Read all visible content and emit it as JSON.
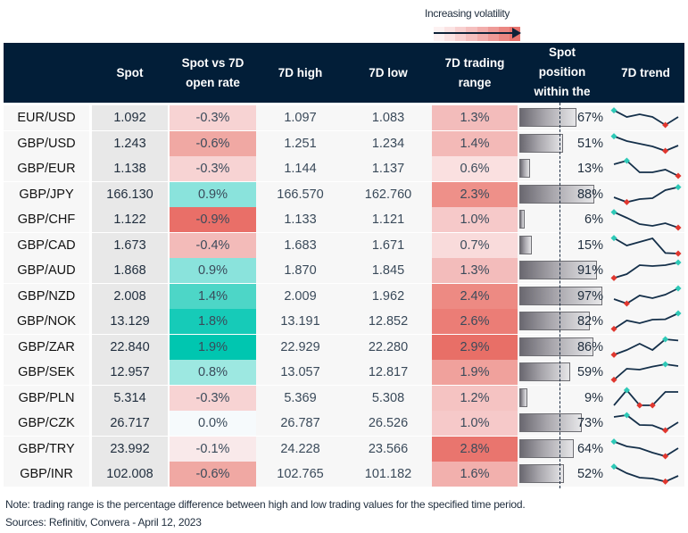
{
  "legend": {
    "label": "Increasing volatility",
    "gradient_colors": [
      "#fdf2f2",
      "#fbe3e3",
      "#f8d0d0",
      "#f5bfbe",
      "#f2adab",
      "#ee9a97",
      "#eb8782",
      "#e8736d"
    ]
  },
  "header": {
    "columns": [
      {
        "key": "pair",
        "label": ""
      },
      {
        "key": "spot",
        "label": "Spot"
      },
      {
        "key": "pct",
        "label": "Spot vs 7D open rate"
      },
      {
        "key": "high",
        "label": "7D high"
      },
      {
        "key": "low",
        "label": "7D low"
      },
      {
        "key": "range",
        "label": "7D trading range"
      },
      {
        "key": "pos",
        "label": "Spot position within the"
      },
      {
        "key": "trend",
        "label": "7D trend"
      }
    ]
  },
  "colors": {
    "header_bg": "#021e38",
    "trend_line": "#15304a",
    "trend_high_marker": "#2ec9b7",
    "trend_low_marker": "#e0372f"
  },
  "rows": [
    {
      "pair": "EUR/USD",
      "spot": "1.092",
      "pct": "-0.3%",
      "pct_color": "#f7d3d3",
      "high": "1.097",
      "low": "1.083",
      "range": "1.3%",
      "range_color": "#f3bcbb",
      "pos": "67%",
      "pos_value": 0.67,
      "trend": [
        0.92,
        0.55,
        0.7,
        0.55,
        0.1,
        0.55
      ],
      "trend_hi": 0,
      "trend_lo": [
        4
      ]
    },
    {
      "pair": "GBP/USD",
      "spot": "1.243",
      "pct": "-0.6%",
      "pct_color": "#f0a8a3",
      "high": "1.251",
      "low": "1.234",
      "range": "1.4%",
      "range_color": "#f3b9b7",
      "pos": "51%",
      "pos_value": 0.51,
      "trend": [
        0.92,
        0.65,
        0.5,
        0.35,
        0.1,
        0.4
      ],
      "trend_hi": 0,
      "trend_lo": [
        4
      ]
    },
    {
      "pair": "GBP/EUR",
      "spot": "1.138",
      "pct": "-0.3%",
      "pct_color": "#f7d3d3",
      "high": "1.144",
      "low": "1.137",
      "range": "0.6%",
      "range_color": "#fae0e0",
      "pos": "13%",
      "pos_value": 0.13,
      "trend": [
        0.75,
        0.95,
        0.3,
        0.3,
        0.45,
        0.1
      ],
      "trend_hi": 1,
      "trend_lo": [
        5
      ]
    },
    {
      "pair": "GBP/JPY",
      "spot": "166.130",
      "pct": "0.9%",
      "pct_color": "#8ae3dc",
      "high": "166.570",
      "low": "162.760",
      "range": "2.3%",
      "range_color": "#ee9089",
      "pos": "88%",
      "pos_value": 0.88,
      "trend": [
        0.35,
        0.08,
        0.25,
        0.3,
        0.75,
        0.92
      ],
      "trend_hi": 5,
      "trend_lo": [
        1
      ]
    },
    {
      "pair": "GBP/CHF",
      "spot": "1.122",
      "pct": "-0.9%",
      "pct_color": "#e96f68",
      "high": "1.133",
      "low": "1.121",
      "range": "1.0%",
      "range_color": "#f6c9c9",
      "pos": "6%",
      "pos_value": 0.06,
      "trend": [
        0.92,
        0.6,
        0.25,
        0.15,
        0.3,
        0.05
      ],
      "trend_hi": 0,
      "trend_lo": [
        5
      ]
    },
    {
      "pair": "GBP/CAD",
      "spot": "1.673",
      "pct": "-0.4%",
      "pct_color": "#f3bbb9",
      "high": "1.683",
      "low": "1.671",
      "range": "0.7%",
      "range_color": "#f9dbdb",
      "pos": "15%",
      "pos_value": 0.15,
      "trend": [
        0.92,
        0.5,
        0.7,
        0.9,
        0.08,
        0.05
      ],
      "trend_hi": 0,
      "trend_lo": [
        5
      ]
    },
    {
      "pair": "GBP/AUD",
      "spot": "1.868",
      "pct": "0.9%",
      "pct_color": "#8ae3dc",
      "high": "1.870",
      "low": "1.845",
      "range": "1.3%",
      "range_color": "#f3bcbb",
      "pos": "91%",
      "pos_value": 0.91,
      "trend": [
        0.08,
        0.3,
        0.8,
        0.75,
        0.8,
        0.95
      ],
      "trend_hi": 5,
      "trend_lo": [
        0
      ]
    },
    {
      "pair": "GBP/NZD",
      "spot": "2.008",
      "pct": "1.4%",
      "pct_color": "#4dd6c7",
      "high": "2.009",
      "low": "1.962",
      "range": "2.4%",
      "range_color": "#ed8a83",
      "pos": "97%",
      "pos_value": 0.97,
      "trend": [
        0.35,
        0.1,
        0.55,
        0.4,
        0.6,
        0.95
      ],
      "trend_hi": 5,
      "trend_lo": [
        1
      ]
    },
    {
      "pair": "GBP/NOK",
      "spot": "13.129",
      "pct": "1.8%",
      "pct_color": "#16cbb8",
      "high": "13.191",
      "low": "12.852",
      "range": "2.6%",
      "range_color": "#eb7d76",
      "pos": "82%",
      "pos_value": 0.82,
      "trend": [
        0.08,
        0.55,
        0.4,
        0.6,
        0.62,
        0.95
      ],
      "trend_hi": 5,
      "trend_lo": [
        0
      ]
    },
    {
      "pair": "GBP/ZAR",
      "spot": "22.840",
      "pct": "1.9%",
      "pct_color": "#00c6b0",
      "high": "22.929",
      "low": "22.280",
      "range": "2.9%",
      "range_color": "#e86f67",
      "pos": "86%",
      "pos_value": 0.86,
      "trend": [
        0.08,
        0.35,
        0.7,
        0.35,
        0.95,
        0.88
      ],
      "trend_hi": 4,
      "trend_lo": [
        0
      ]
    },
    {
      "pair": "GBP/SEK",
      "spot": "12.957",
      "pct": "0.8%",
      "pct_color": "#9de8e1",
      "high": "13.057",
      "low": "12.817",
      "range": "1.9%",
      "range_color": "#f0a19c",
      "pos": "59%",
      "pos_value": 0.59,
      "trend": [
        0.08,
        0.7,
        0.65,
        0.82,
        0.95,
        0.85
      ],
      "trend_hi": 4,
      "trend_lo": [
        0
      ]
    },
    {
      "pair": "GBP/PLN",
      "spot": "5.314",
      "pct": "-0.3%",
      "pct_color": "#f7d3d3",
      "high": "5.369",
      "low": "5.308",
      "range": "1.2%",
      "range_color": "#f5c3c2",
      "pos": "9%",
      "pos_value": 0.09,
      "trend": [
        0.1,
        0.95,
        0.1,
        0.1,
        0.85,
        0.85
      ],
      "trend_hi": 1,
      "trend_lo": [
        2,
        3
      ]
    },
    {
      "pair": "GBP/CZK",
      "spot": "26.717",
      "pct": "0.0%",
      "pct_color": "#f6fafc",
      "high": "26.787",
      "low": "26.526",
      "range": "1.0%",
      "range_color": "#f6c9c9",
      "pos": "73%",
      "pos_value": 0.73,
      "trend": [
        0.85,
        0.95,
        0.4,
        0.38,
        0.1,
        0.55
      ],
      "trend_hi": 1,
      "trend_lo": [
        4
      ]
    },
    {
      "pair": "GBP/TRY",
      "spot": "23.992",
      "pct": "-0.1%",
      "pct_color": "#f9e9ea",
      "high": "24.228",
      "low": "23.566",
      "range": "2.8%",
      "range_color": "#e9756e",
      "pos": "64%",
      "pos_value": 0.64,
      "trend": [
        0.92,
        0.65,
        0.55,
        0.3,
        0.1,
        0.55
      ],
      "trend_hi": 0,
      "trend_lo": [
        4
      ]
    },
    {
      "pair": "GBP/INR",
      "spot": "102.008",
      "pct": "-0.6%",
      "pct_color": "#f0a8a3",
      "high": "102.765",
      "low": "101.182",
      "range": "1.6%",
      "range_color": "#f2b0ad",
      "pos": "52%",
      "pos_value": 0.52,
      "trend": [
        0.92,
        0.55,
        0.3,
        0.25,
        0.08,
        0.4
      ],
      "trend_hi": 0,
      "trend_lo": [
        4
      ]
    }
  ],
  "footer": {
    "note": "Note: trading range is the percentage difference between high and low trading values for the specified time period.",
    "sources": "Sources: Refinitiv, Convera - April 12, 2023"
  }
}
